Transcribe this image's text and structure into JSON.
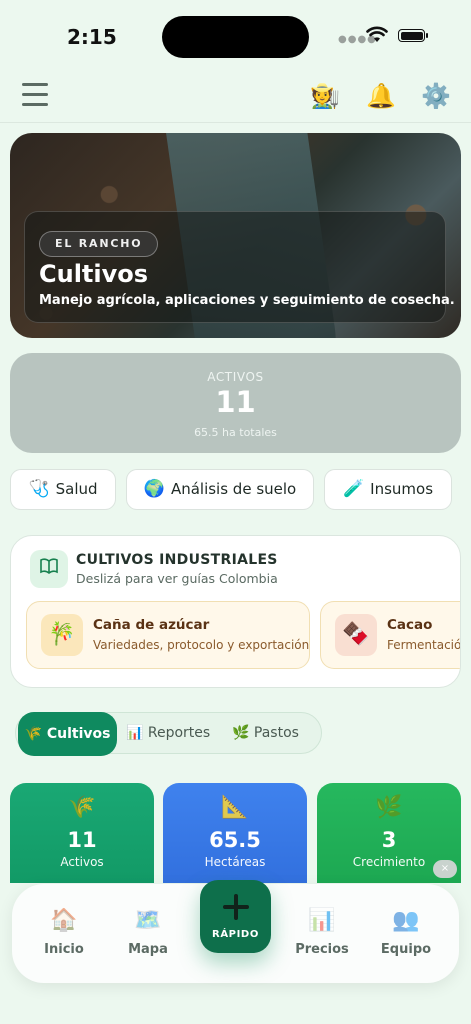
{
  "status_bar": {
    "time": "2:15"
  },
  "top_bar": {
    "icons": [
      "menu-icon",
      "farmer-icon",
      "bell-icon",
      "gear-icon"
    ]
  },
  "hero": {
    "badge": "EL RANCHO",
    "title": "Cultivos",
    "subtitle": "Manejo agrícola, aplicaciones y seguimiento de cosecha."
  },
  "summary": {
    "label": "ACTIVOS",
    "value": "11",
    "sub": "65.5 ha totales"
  },
  "quick_actions": [
    {
      "label": "Salud",
      "icon": "stethoscope-icon"
    },
    {
      "label": "Análisis de suelo",
      "icon": "globe-icon"
    },
    {
      "label": "Insumos",
      "icon": "test-tube-icon"
    }
  ],
  "industrial": {
    "title": "CULTIVOS INDUSTRIALES",
    "subtitle": "Deslizá para ver guías Colombia",
    "guides": [
      {
        "title": "Caña de azúcar",
        "subtitle": "Variedades, protocolo y exportación",
        "icon": "sugarcane-icon"
      },
      {
        "title": "Cacao",
        "subtitle": "Fermentación",
        "icon": "chocolate-icon"
      }
    ]
  },
  "tabs": [
    {
      "label": "Cultivos",
      "icon": "wheat-icon",
      "active": true
    },
    {
      "label": "Reportes",
      "icon": "bar-chart-icon",
      "active": false
    },
    {
      "label": "Pastos",
      "icon": "herb-icon",
      "active": false
    }
  ],
  "stats": [
    {
      "value": "11",
      "label": "Activos",
      "icon": "wheat-icon",
      "color": "#16a06a"
    },
    {
      "value": "65.5",
      "label": "Hectáreas",
      "icon": "ruler-icon",
      "color": "#3b7be6"
    },
    {
      "value": "3",
      "label": "Crecimiento",
      "icon": "herb-icon",
      "color": "#20b25a"
    }
  ],
  "bottom_nav": {
    "items": [
      {
        "label": "Inicio",
        "icon": "house-icon"
      },
      {
        "label": "Mapa",
        "icon": "map-icon"
      },
      {
        "label": "Precios",
        "icon": "bar-chart-icon"
      },
      {
        "label": "Equipo",
        "icon": "people-icon"
      }
    ],
    "fab_label": "RÁPIDO",
    "close": "×"
  }
}
